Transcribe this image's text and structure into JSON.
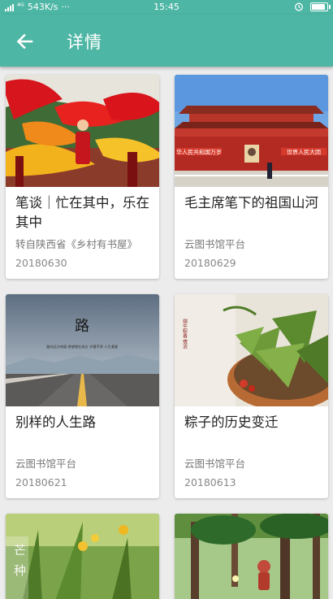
{
  "status_bar": {
    "network": "543K/s",
    "more": "···",
    "time": "15:45"
  },
  "app_bar": {
    "title": "详情",
    "color": "#4db6a4"
  },
  "articles": [
    {
      "title": "笔谈｜忙在其中，乐在其中",
      "source": "转自陕西省《乡村有书屋》",
      "date": "20180630"
    },
    {
      "title": "毛主席笔下的祖国山河",
      "source": "云图书馆平台",
      "date": "20180629"
    },
    {
      "title": "别样的人生路",
      "source": "云图书馆平台",
      "date": "20180621"
    },
    {
      "title": "粽子的历史变迁",
      "source": "云图书馆平台",
      "date": "20180613"
    },
    {
      "title": "",
      "source": "",
      "date": ""
    },
    {
      "title": "",
      "source": "",
      "date": ""
    }
  ],
  "image_text": {
    "road_char": "路",
    "road_caption": "路向远方伸展 希望就在前方 步履不停 人生漫漫",
    "zongzi_vertical": "端午粽香 情浓",
    "grain_line1": "芒",
    "grain_line2": "种",
    "tiananmen_left_banner": "华人民共和国万岁",
    "tiananmen_right_banner": "世界人民大团"
  }
}
